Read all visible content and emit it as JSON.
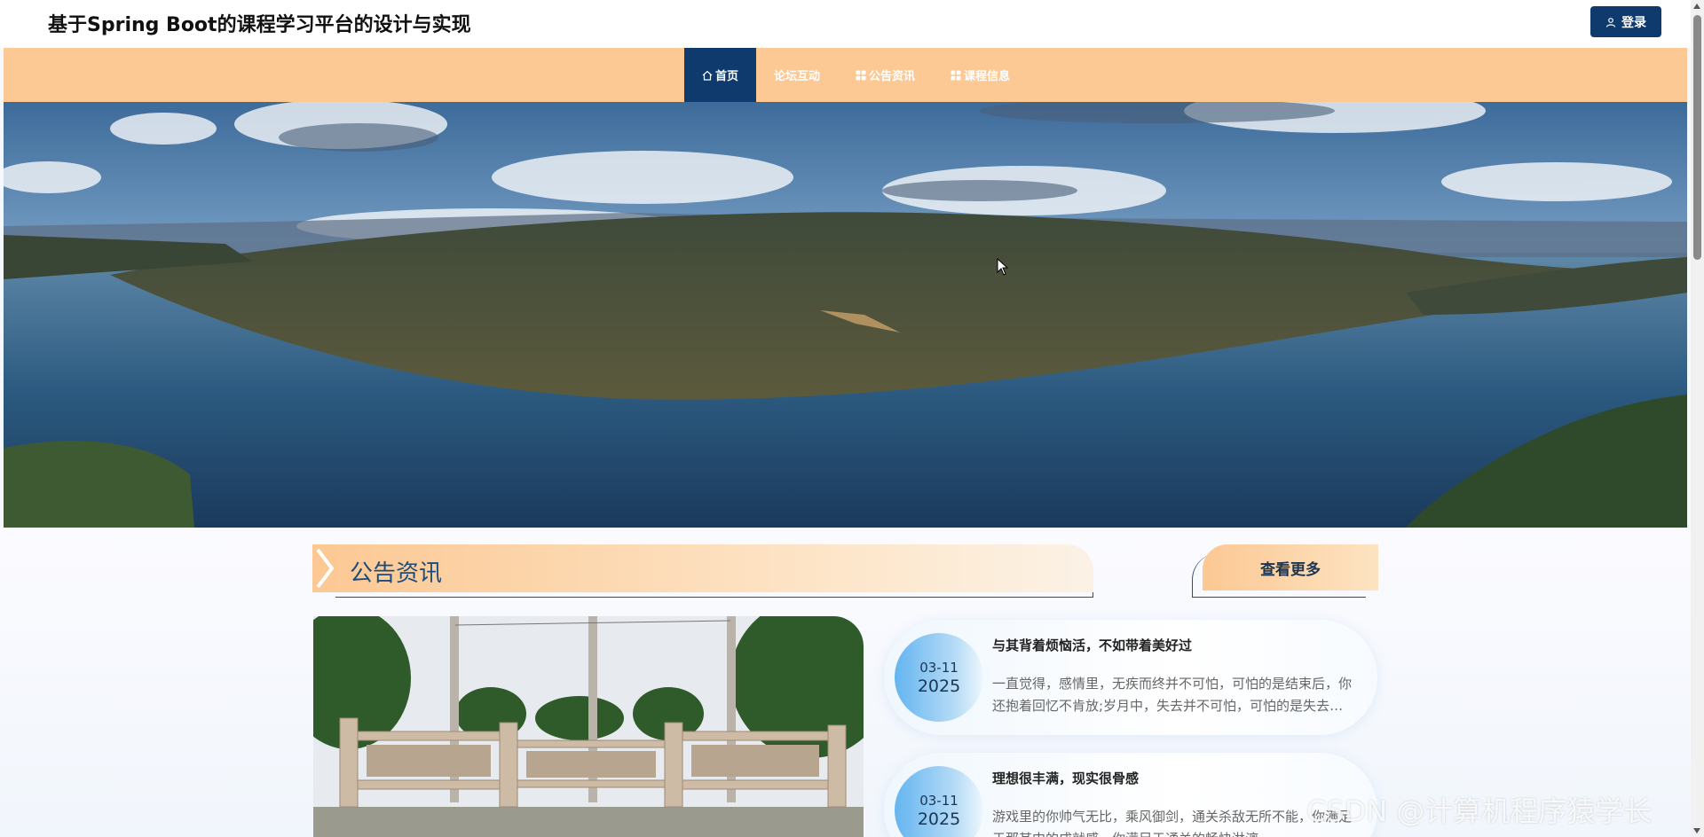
{
  "header": {
    "site_title": "基于Spring Boot的课程学习平台的设计与实现",
    "login_label": "登录"
  },
  "nav": {
    "items": [
      {
        "label": "首页",
        "icon": "home-icon",
        "active": true
      },
      {
        "label": "论坛互动",
        "icon": "",
        "active": false
      },
      {
        "label": "公告资讯",
        "icon": "grid-icon",
        "active": false
      },
      {
        "label": "课程信息",
        "icon": "grid-icon",
        "active": false
      }
    ]
  },
  "section": {
    "title": "公告资讯",
    "more_label": "查看更多"
  },
  "news": [
    {
      "date_md": "03-11",
      "date_year": "2025",
      "title": "与其背着烦恼活，不如带着美好过",
      "desc": "一直觉得，感情里，无疾而终并不可怕，可怕的是结束后，你还抱着回忆不肯放;岁月中，失去并不可怕，可怕的是失去后，你还念念不忘。"
    },
    {
      "date_md": "03-11",
      "date_year": "2025",
      "title": "理想很丰满，现实很骨感",
      "desc": "游戏里的你帅气无比，乘风御剑，通关杀敌无所不能，你满足于那其中的成就感，你满足于通关的畅快淋漓。"
    }
  ],
  "watermark": "CSDN @计算机程序猿学长",
  "colors": {
    "nav_bg": "#fcc893",
    "accent_navy": "#0f3a6e",
    "section_title": "#1d4b7a"
  }
}
